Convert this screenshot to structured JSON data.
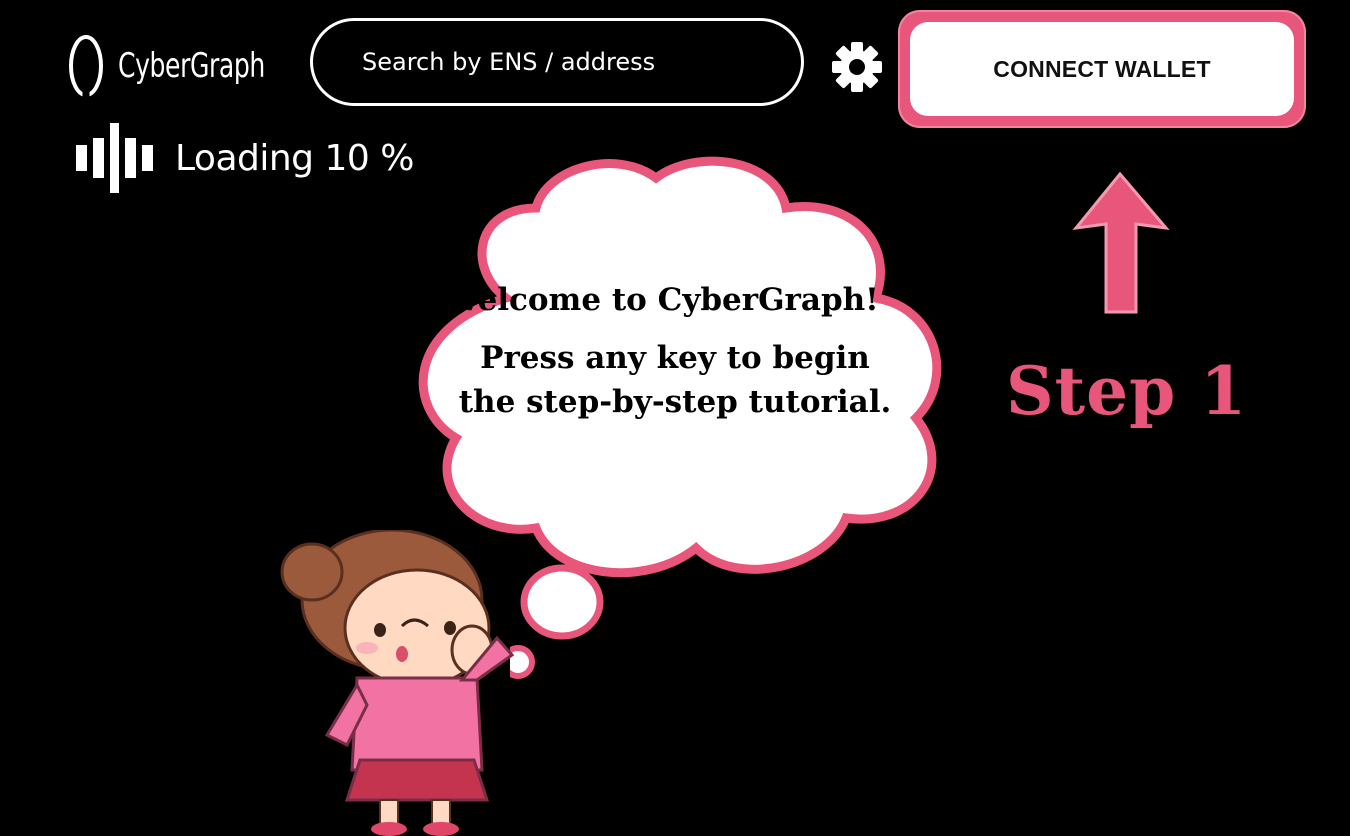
{
  "header": {
    "brand": "CyberGraph",
    "search": {
      "placeholder": "Search by ENS / address",
      "value": ""
    },
    "settings_icon": "gear-icon",
    "connect_label": "CONNECT WALLET"
  },
  "loading": {
    "label": "Loading 10 %",
    "progress_percent": 10
  },
  "tutorial": {
    "welcome": "Welcome to CyberGraph!",
    "instruction_line1": "Press any key to begin",
    "instruction_line2": "the step-by-step tutorial.",
    "step_label": "Step 1"
  },
  "colors": {
    "accent": "#e9567b",
    "background": "#000000",
    "foreground": "#ffffff"
  }
}
